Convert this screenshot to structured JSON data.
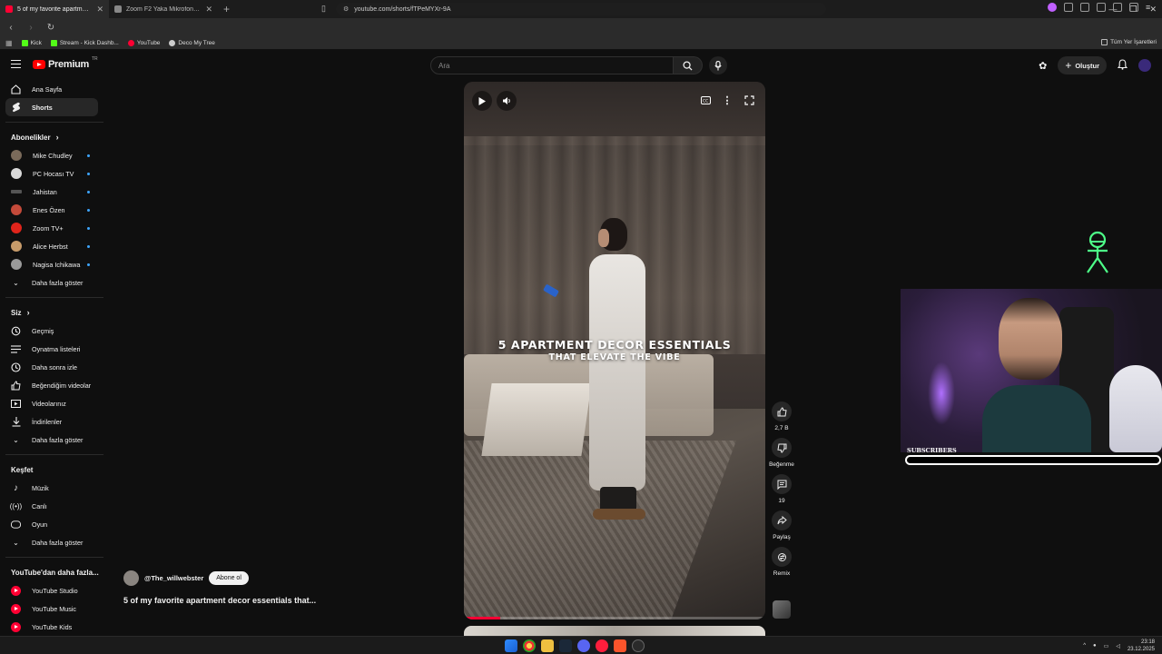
{
  "browser": {
    "tabs": [
      {
        "title": "5 of my favorite apartment decor",
        "active": true
      },
      {
        "title": "Zoom F2 Yaka Mikrofonu ve Ses Kay...",
        "active": false
      }
    ],
    "url": "youtube.com/shorts/fTPeMYXr-9A",
    "bookmarks": [
      "Kick",
      "Stream - Kick Dashb...",
      "YouTube",
      "Deco My Tree"
    ],
    "bookmarks_right": "Tüm Yer İşaretleri"
  },
  "header": {
    "logo_text": "Premium",
    "logo_region": "TR",
    "search_placeholder": "Ara",
    "create_label": "Oluştur"
  },
  "sidebar": {
    "main": [
      {
        "label": "Ana Sayfa",
        "icon": "home-icon"
      },
      {
        "label": "Shorts",
        "icon": "shorts-icon"
      }
    ],
    "subscriptions_title": "Abonelikler",
    "subscriptions": [
      {
        "label": "Mike Chudley",
        "color": "#7a6a5a"
      },
      {
        "label": "PC Hocası TV",
        "color": "#d9d9d9"
      },
      {
        "label": "Jahistan",
        "color": "#555555"
      },
      {
        "label": "Enes Özen",
        "color": "#c44a3a"
      },
      {
        "label": "Zoom TV+",
        "color": "#e0241b"
      },
      {
        "label": "Alice Herbst",
        "color": "#c79b6a"
      },
      {
        "label": "Nagisa Ichikawa",
        "color": "#9a9a9a"
      }
    ],
    "show_more": "Daha fazla göster",
    "you_title": "Siz",
    "you": [
      {
        "label": "Geçmiş",
        "icon": "history-icon"
      },
      {
        "label": "Oynatma listeleri",
        "icon": "playlist-icon"
      },
      {
        "label": "Daha sonra izle",
        "icon": "clock-icon"
      },
      {
        "label": "Beğendiğim videolar",
        "icon": "like-icon"
      },
      {
        "label": "Videolarınız",
        "icon": "video-icon"
      },
      {
        "label": "İndirilenler",
        "icon": "download-icon"
      }
    ],
    "explore_title": "Keşfet",
    "explore": [
      {
        "label": "Müzik",
        "icon": "music-icon"
      },
      {
        "label": "Canlı",
        "icon": "live-icon"
      },
      {
        "label": "Oyun",
        "icon": "gaming-icon"
      }
    ],
    "more_title": "YouTube'dan daha fazla...",
    "more": [
      {
        "label": "YouTube Studio"
      },
      {
        "label": "YouTube Music"
      },
      {
        "label": "YouTube Kids"
      }
    ]
  },
  "video": {
    "overlay_line1": "5 APARTMENT DECOR ESSENTIALS",
    "overlay_line2": "THAT ELEVATE THE VIBE",
    "progress": 0.12,
    "channel": "@The_willwebster",
    "subscribe_label": "Abone ol",
    "title": "5 of my favorite apartment decor essentials that..."
  },
  "actions": {
    "like_count": "2,7 B",
    "dislike_label": "Beğenme",
    "comment_count": "19",
    "share_label": "Paylaş",
    "remix_label": "Remix"
  },
  "stream_overlay": {
    "subscribers_label": "SUBSCRIBERS",
    "subscribers_progress": 0.0
  },
  "taskbar": {
    "time": "23:18",
    "date": "23.12.2025"
  }
}
